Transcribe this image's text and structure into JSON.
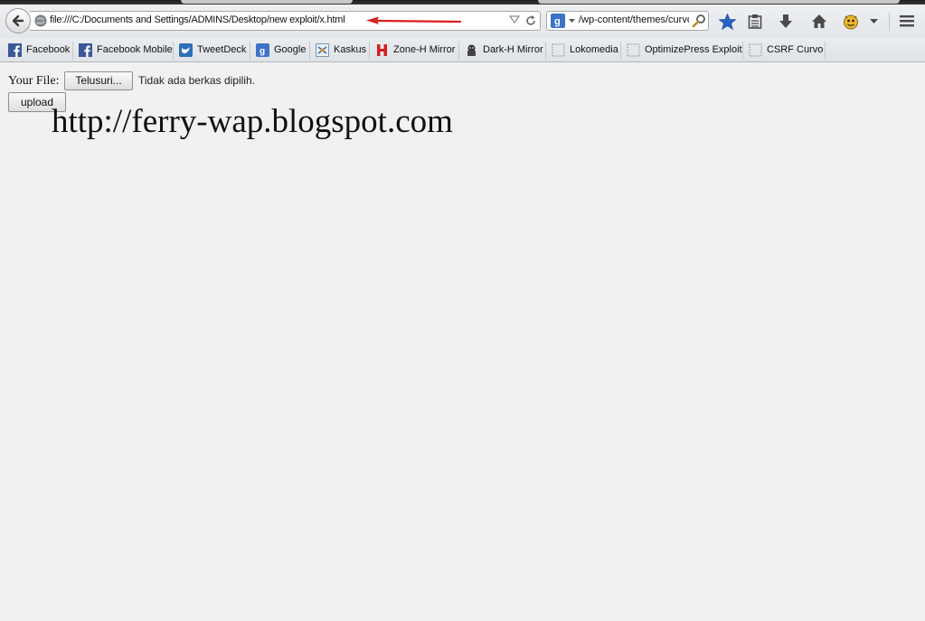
{
  "address_bar": {
    "url": "file:///C:/Documents and Settings/ADMINS/Desktop/new exploit/x.html"
  },
  "search_bar": {
    "value": "/wp-content/themes/curvo",
    "engine_icon": "google-icon"
  },
  "toolbar": {
    "icons": [
      "bookmark-star-icon",
      "reading-list-icon",
      "downloads-icon",
      "home-icon",
      "extension-icon",
      "menu-icon"
    ]
  },
  "bookmarks": [
    {
      "label": "Facebook",
      "icon": "facebook-icon"
    },
    {
      "label": "Facebook Mobile",
      "icon": "facebook-icon"
    },
    {
      "label": "TweetDeck",
      "icon": "tweetdeck-icon"
    },
    {
      "label": "Google",
      "icon": "google-icon"
    },
    {
      "label": "Kaskus",
      "icon": "kaskus-icon"
    },
    {
      "label": "Zone-H Mirror",
      "icon": "zone-h-icon"
    },
    {
      "label": "Dark-H Mirror",
      "icon": "dark-h-icon"
    },
    {
      "label": "Lokomedia",
      "icon": "blank-page-icon"
    },
    {
      "label": "OptimizePress Exploit",
      "icon": "blank-page-icon"
    },
    {
      "label": "CSRF Curvo",
      "icon": "blank-page-icon"
    }
  ],
  "page": {
    "file_label": "Your File:",
    "browse_button": "Telusuri...",
    "no_file_text": "Tidak ada berkas dipilih.",
    "upload_button": "upload",
    "blog_url": "http://ferry-wap.blogspot.com"
  },
  "colors": {
    "annotation_arrow": "#d92020",
    "star_blue": "#2a63c9",
    "facebook_blue": "#3b5998"
  }
}
